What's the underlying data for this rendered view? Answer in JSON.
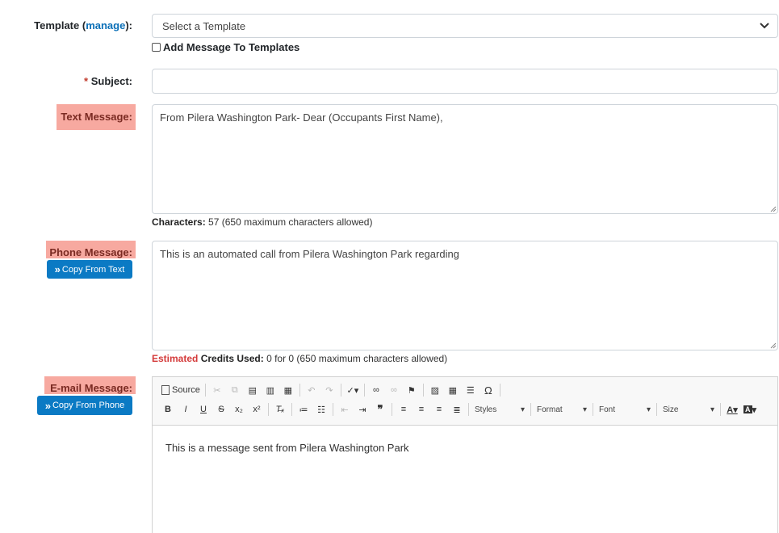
{
  "template": {
    "label_prefix": "Template (",
    "label_link": "manage",
    "label_suffix": "):",
    "selected": "Select a Template",
    "add_checkbox_label": "Add Message To Templates"
  },
  "subject": {
    "required_mark": "*",
    "label": "Subject:",
    "value": ""
  },
  "text_message": {
    "label": "Text Message:",
    "value": "From Pilera Washington Park- Dear (Occupants First Name),",
    "characters_label": "Characters:",
    "characters_value": "57 (650 maximum characters allowed)"
  },
  "phone_message": {
    "label": "Phone Message:",
    "copy_button": "Copy From Text",
    "value": "This is an automated call from Pilera Washington Park regarding",
    "estimated_label": "Estimated",
    "credits_label": "Credits Used:",
    "credits_value": "0 for 0 (650 maximum characters allowed)"
  },
  "email_message": {
    "label": "E-mail Message:",
    "copy_button": "Copy From Phone",
    "source_label": "Source",
    "styles_label": "Styles",
    "format_label": "Format",
    "font_label": "Font",
    "size_label": "Size",
    "body": "This is a message sent from Pilera Washington Park"
  },
  "colors": {
    "highlight": "#f7a9a0",
    "button": "#0b7ac4",
    "link": "#0b6fb7",
    "required": "#c0392b",
    "estimated": "#d43a3a"
  }
}
